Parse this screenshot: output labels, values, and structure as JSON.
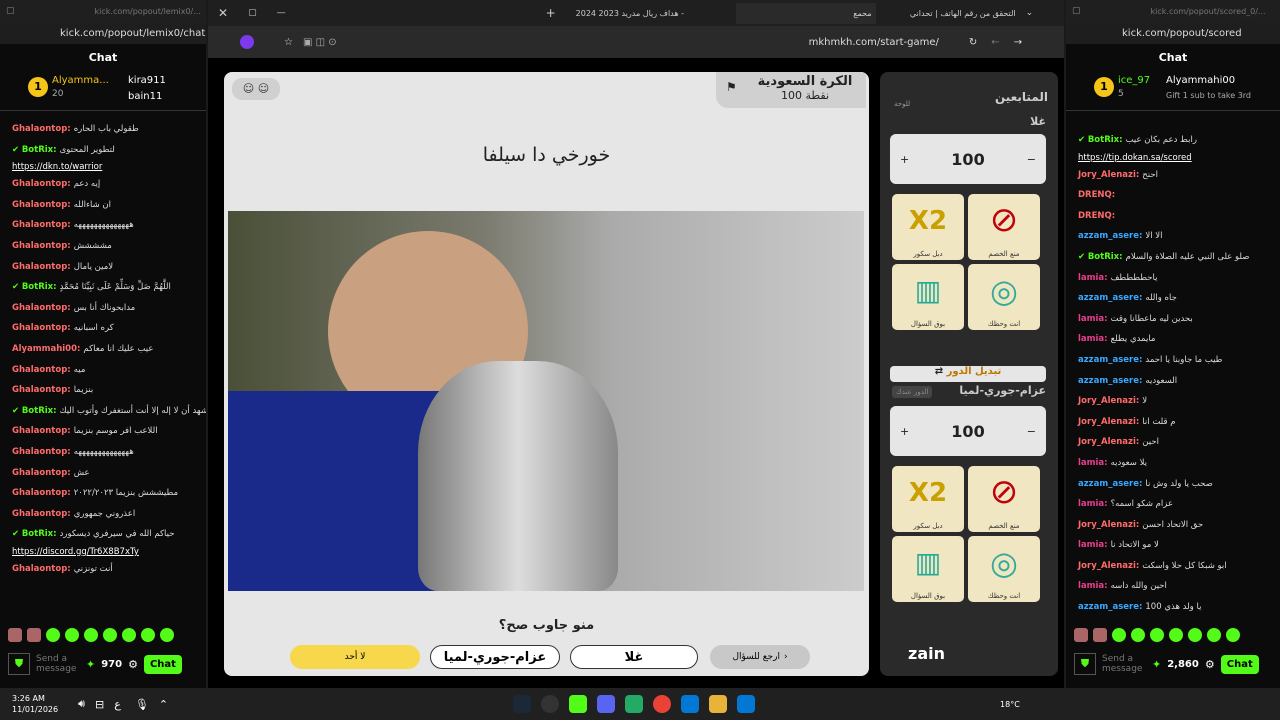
{
  "left_window": {
    "url": "kick.com/popout/lemix0/chat",
    "tab_url": "kick.com/popout/lemix0/...",
    "chat_title": "Chat",
    "leaders": [
      {
        "name": "Alyamma...",
        "sub": "20"
      },
      {
        "name": "kira911"
      },
      {
        "name": "bain11"
      }
    ],
    "messages": [
      {
        "user": "Ghalaontop:",
        "text": "طقولي باب الحاره"
      },
      {
        "user": "BotRix:",
        "text": "لتطوير المحتوى",
        "link": "https://dkn.to/warrior",
        "bot": true
      },
      {
        "user": "Ghalaontop:",
        "text": "إيه دعم"
      },
      {
        "user": "Ghalaontop:",
        "text": "ان شاءالله"
      },
      {
        "user": "Ghalaontop:",
        "text": "ههههههههههههههه"
      },
      {
        "user": "Ghalaontop:",
        "text": "مشششش"
      },
      {
        "user": "Ghalaontop:",
        "text": "لامين يامال"
      },
      {
        "user": "BotRix:",
        "text": "اللَّهُمَّ صَلِّ وَسَلِّمْ عَلَى نَبِيِّنَا مُحَمَّدٍ",
        "bot": true
      },
      {
        "user": "Ghalaontop:",
        "text": "مدابحوناك أنا بس"
      },
      {
        "user": "Ghalaontop:",
        "text": "كره اسبانيه"
      },
      {
        "user": "Alyammahi00:",
        "text": "عيب عليك انا معاكم"
      },
      {
        "user": "Ghalaontop:",
        "text": "ميه"
      },
      {
        "user": "Ghalaontop:",
        "text": "بنزيما"
      },
      {
        "user": "BotRix:",
        "text": "سبحانك اللهم وبحمدك اشهد أن لا إله إلا أنت أستغفرك وأتوب اليك",
        "bot": true
      },
      {
        "user": "Ghalaontop:",
        "text": "اللاعب افر موسم بنزيما"
      },
      {
        "user": "Ghalaontop:",
        "text": "ههههههههههههههه"
      },
      {
        "user": "Ghalaontop:",
        "text": "عش"
      },
      {
        "user": "Ghalaontop:",
        "text": "مطيششش بنزيما ٢٠٢٢/٢٠٢٣"
      },
      {
        "user": "Ghalaontop:",
        "text": "اعذروني جمهوري"
      },
      {
        "user": "BotRix:",
        "text": "حياكم الله في سيرفري ديسكورد",
        "link": "https://discord.gg/Tr6X8B7xTy",
        "bot": true
      },
      {
        "user": "Ghalaontop:",
        "text": "أنت تونزني"
      }
    ],
    "send_placeholder": "Send a message",
    "points": "970",
    "chat_btn": "Chat"
  },
  "right_window": {
    "url": "kick.com/popout/scored",
    "tab_url": "kick.com/popout/scored_0/...",
    "chat_title": "Chat",
    "leaders": [
      {
        "name": "ice_97",
        "sub": "5"
      },
      {
        "name": "Alyammahi00"
      },
      {
        "name": "Gift 1 sub to take 3rd"
      }
    ],
    "messages": [
      {
        "user": "BotRix:",
        "text": "رابط دعم بكان عيب",
        "link": "https://tip.dokan.sa/scored",
        "bot": true
      },
      {
        "user": "Jory_Alenazi:",
        "text": "احنح"
      },
      {
        "user": "DRENQ:",
        "text": ""
      },
      {
        "user": "DRENQ:",
        "text": ""
      },
      {
        "user": "azzam_asere:",
        "text": "الا الا"
      },
      {
        "user": "BotRix:",
        "text": "صلو على النبي عليه الصلاة والسلام",
        "bot": true
      },
      {
        "user": "lamia:",
        "text": "ياحططططف"
      },
      {
        "user": "azzam_asere:",
        "text": "جاه والله"
      },
      {
        "user": "lamia:",
        "text": "بحدين ليه ماعطانا وقت"
      },
      {
        "user": "lamia:",
        "text": "مايمدي يطلع"
      },
      {
        "user": "azzam_asere:",
        "text": "طيب ما جاوبنا يا احمد"
      },
      {
        "user": "azzam_asere:",
        "text": "السعوديه"
      },
      {
        "user": "Jory_Alenazi:",
        "text": "لا"
      },
      {
        "user": "Jory_Alenazi:",
        "text": "م قلت انا"
      },
      {
        "user": "Jory_Alenazi:",
        "text": "احين"
      },
      {
        "user": "lamia:",
        "text": "يلا سعوديه"
      },
      {
        "user": "azzam_asere:",
        "text": "صحب يا ولد وش نا"
      },
      {
        "user": "lamia:",
        "text": "عزام شكو اسمه؟"
      },
      {
        "user": "Jory_Alenazi:",
        "text": "حق الاتحاد احسن"
      },
      {
        "user": "lamia:",
        "text": "لا مو الاتحاد نا"
      },
      {
        "user": "Jory_Alenazi:",
        "text": "ابو شبكا كل حلا واسكت"
      },
      {
        "user": "lamia:",
        "text": "احين والله داسه"
      },
      {
        "user": "azzam_asere:",
        "text": "يا ولد هذي 100"
      }
    ],
    "send_placeholder": "Send a message",
    "points": "2,860",
    "chat_btn": "Chat"
  },
  "browser": {
    "tabs": [
      "التحقق من رقم الهاتف | تحداني",
      "محمع",
      "هداف ريال مدريد 2023 2024 -"
    ],
    "url": "mkhmkh.com/start-game/"
  },
  "game": {
    "category": "الكرة السعودية",
    "points": "100 نقطة",
    "question": "خورخي دا سيلفا",
    "prompt": "منو جاوب صح؟",
    "answers": {
      "none": "لا أحد",
      "team2": "عزام-جوري-لميا",
      "team1": "غلا",
      "back": "ارجع للسؤال"
    },
    "sidebar": {
      "header": "المتابعين",
      "board": "للوحة",
      "team1_name": "غلا",
      "team1_score": "100",
      "switch_turn": "تبديل الدور",
      "team2_name": "عزام-جوري-لميا",
      "your_turn": "الدور عندك",
      "team2_score": "100",
      "cards": [
        "X2",
        "منع الخصم",
        "بوق السؤال",
        "أنت وحظك"
      ],
      "card_subs": [
        "دبل سكور",
        "منع الخصم",
        "بوق السؤال",
        "انت وحظك"
      ],
      "zain": "zain"
    }
  },
  "taskbar": {
    "time": "3:26 AM",
    "date": "11/01/2026",
    "lang": "ع",
    "temp": "18°C"
  }
}
